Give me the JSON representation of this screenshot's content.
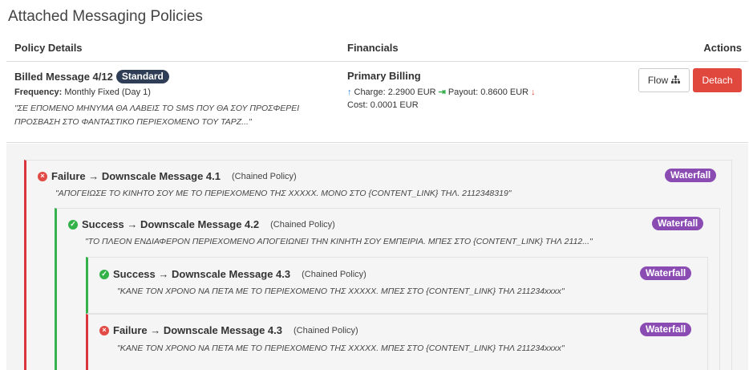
{
  "page": {
    "title": "Attached Messaging Policies"
  },
  "table": {
    "headers": {
      "policy": "Policy Details",
      "financials": "Financials",
      "actions": "Actions"
    }
  },
  "policy": {
    "name": "Billed Message 4/12",
    "badge": "Standard",
    "frequency_label": "Frequency:",
    "frequency_value": "Monthly Fixed (Day 1)",
    "message": "\"ΣΕ ΕΠΟΜΕΝΟ ΜΗΝΥΜΑ ΘΑ ΛΑΒΕΙΣ ΤΟ SMS ΠΟΥ ΘΑ ΣΟΥ ΠΡΟΣΦΕΡΕΙ ΠΡΟΣΒΑΣΗ ΣΤΟ ΦΑΝΤΑΣΤΙΚΟ ΠΕΡΙΕΧΟΜΕΝΟ ΤΟΥ ΤΑΡΖ...\"",
    "financials": {
      "title": "Primary Billing",
      "charge": "Charge: 2.2900 EUR",
      "payout": "Payout: 0.8600 EUR",
      "cost": "Cost: 0.0001 EUR"
    },
    "actions": {
      "flow": "Flow",
      "detach": "Detach"
    }
  },
  "chain": [
    {
      "status": "failure",
      "title": "Failure → Downscale Message 4.1",
      "tag": "(Chained Policy)",
      "badge": "Waterfall",
      "message": "\"ΑΠΟΓΕΙΩΣΕ ΤΟ ΚΙΝΗΤΟ ΣΟΥ ΜΕ ΤΟ ΠΕΡΙΕΧΟΜΕΝΟ ΤΗΣ XXXXX. ΜΟΝΟ ΣΤΟ {CONTENT_LINK} ΤΗΛ. 2112348319\""
    },
    {
      "status": "success",
      "title": "Success → Downscale Message 4.2",
      "tag": "(Chained Policy)",
      "badge": "Waterfall",
      "message": "\"ΤΟ ΠΛΕΟΝ ΕΝΔΙΑΦΕΡΟΝ ΠΕΡΙΕΧΟΜΕΝΟ ΑΠΟΓΕΙΩΝΕΙ ΤΗΝ ΚΙΝΗΤΗ ΣΟΥ ΕΜΠΕΙΡΙΑ. ΜΠΕΣ ΣΤΟ {CONTENT_LINK} ΤΗΛ 2112...\""
    },
    {
      "status": "success",
      "title": "Success → Downscale Message 4.3",
      "tag": "(Chained Policy)",
      "badge": "Waterfall",
      "message": "\"ΚΑΝΕ ΤΟΝ ΧΡΟΝΟ ΝΑ ΠΕΤΑ ΜΕ ΤΟ ΠΕΡΙΕΧΟΜΕΝΟ ΤΗΣ XXXXX. ΜΠΕΣ ΣΤΟ {CONTENT_LINK} ΤΗΛ 211234xxxx\""
    },
    {
      "status": "failure",
      "title": "Failure → Downscale Message 4.3",
      "tag": "(Chained Policy)",
      "badge": "Waterfall",
      "message": "\"ΚΑΝΕ ΤΟΝ ΧΡΟΝΟ ΝΑ ΠΕΤΑ ΜΕ ΤΟ ΠΕΡΙΕΧΟΜΕΝΟ ΤΗΣ XXXXX. ΜΠΕΣ ΣΤΟ {CONTENT_LINK} ΤΗΛ 211234xxxx\""
    }
  ],
  "colors": {
    "failure": "#d9363e",
    "success": "#36b04a",
    "waterfall_badge": "#8a4bb3",
    "standard_badge": "#2f3e56",
    "detach_button": "#e0483e"
  },
  "icons": {
    "flow": "sitemap-icon",
    "charge": "arrow-up-icon",
    "payout": "arrow-in-icon",
    "payout_trend": "arrow-down-icon",
    "failure": "x-circle-icon",
    "success": "check-circle-icon"
  }
}
